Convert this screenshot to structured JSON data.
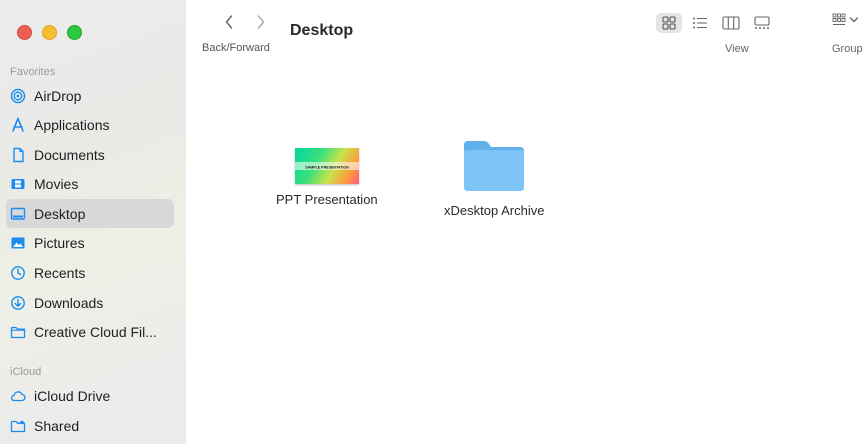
{
  "sidebar": {
    "favorites_title": "Favorites",
    "favorites": [
      {
        "label": "AirDrop",
        "icon": "airdrop-icon"
      },
      {
        "label": "Applications",
        "icon": "applications-icon"
      },
      {
        "label": "Documents",
        "icon": "document-icon"
      },
      {
        "label": "Movies",
        "icon": "film-icon"
      },
      {
        "label": "Desktop",
        "icon": "desktop-icon",
        "selected": true
      },
      {
        "label": "Pictures",
        "icon": "pictures-icon"
      },
      {
        "label": "Recents",
        "icon": "clock-icon"
      },
      {
        "label": "Downloads",
        "icon": "download-icon"
      },
      {
        "label": "Creative Cloud Fil...",
        "icon": "folder-icon"
      }
    ],
    "icloud_title": "iCloud",
    "icloud": [
      {
        "label": "iCloud Drive",
        "icon": "cloud-icon"
      },
      {
        "label": "Shared",
        "icon": "shared-folder-icon"
      }
    ]
  },
  "toolbar": {
    "nav_caption": "Back/Forward",
    "folder_title": "Desktop",
    "view_caption": "View",
    "group_caption": "Group"
  },
  "files": [
    {
      "label": "PPT Presentation",
      "thumb_text": "SAMPLE PRESENTATION",
      "icon": "presentation-thumbnail"
    },
    {
      "label": "xDesktop Archive",
      "icon": "folder-icon"
    }
  ],
  "colors": {
    "accent": "#1a8cf0",
    "folder": "#7cc4f5",
    "folder_tab": "#5fb1ea",
    "sidebar_selected": "#d8d8d8"
  }
}
